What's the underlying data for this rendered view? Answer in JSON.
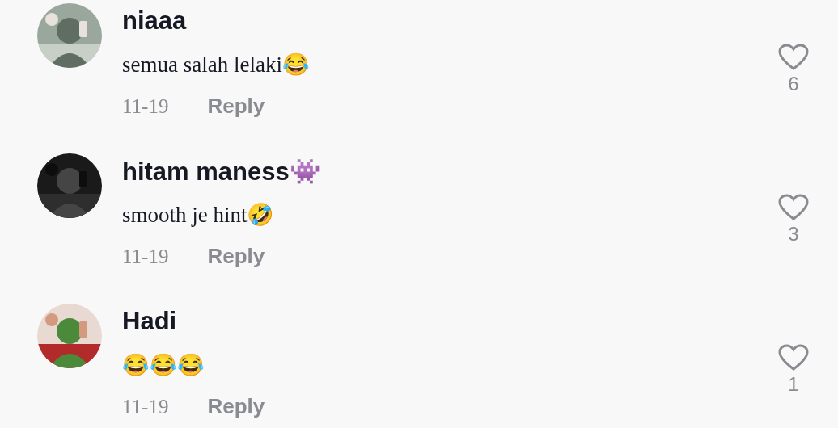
{
  "comments": [
    {
      "username": "niaaa",
      "text": "semua salah lelaki😂",
      "date": "11-19",
      "reply": "Reply",
      "likes": "6",
      "liked": false
    },
    {
      "username": "hitam maness👾",
      "text": "smooth je hint🤣",
      "date": "11-19",
      "reply": "Reply",
      "likes": "3",
      "liked": false
    },
    {
      "username": "Hadi",
      "text": "😂😂😂",
      "date": "11-19",
      "reply": "Reply",
      "likes": "1",
      "liked": false
    }
  ]
}
